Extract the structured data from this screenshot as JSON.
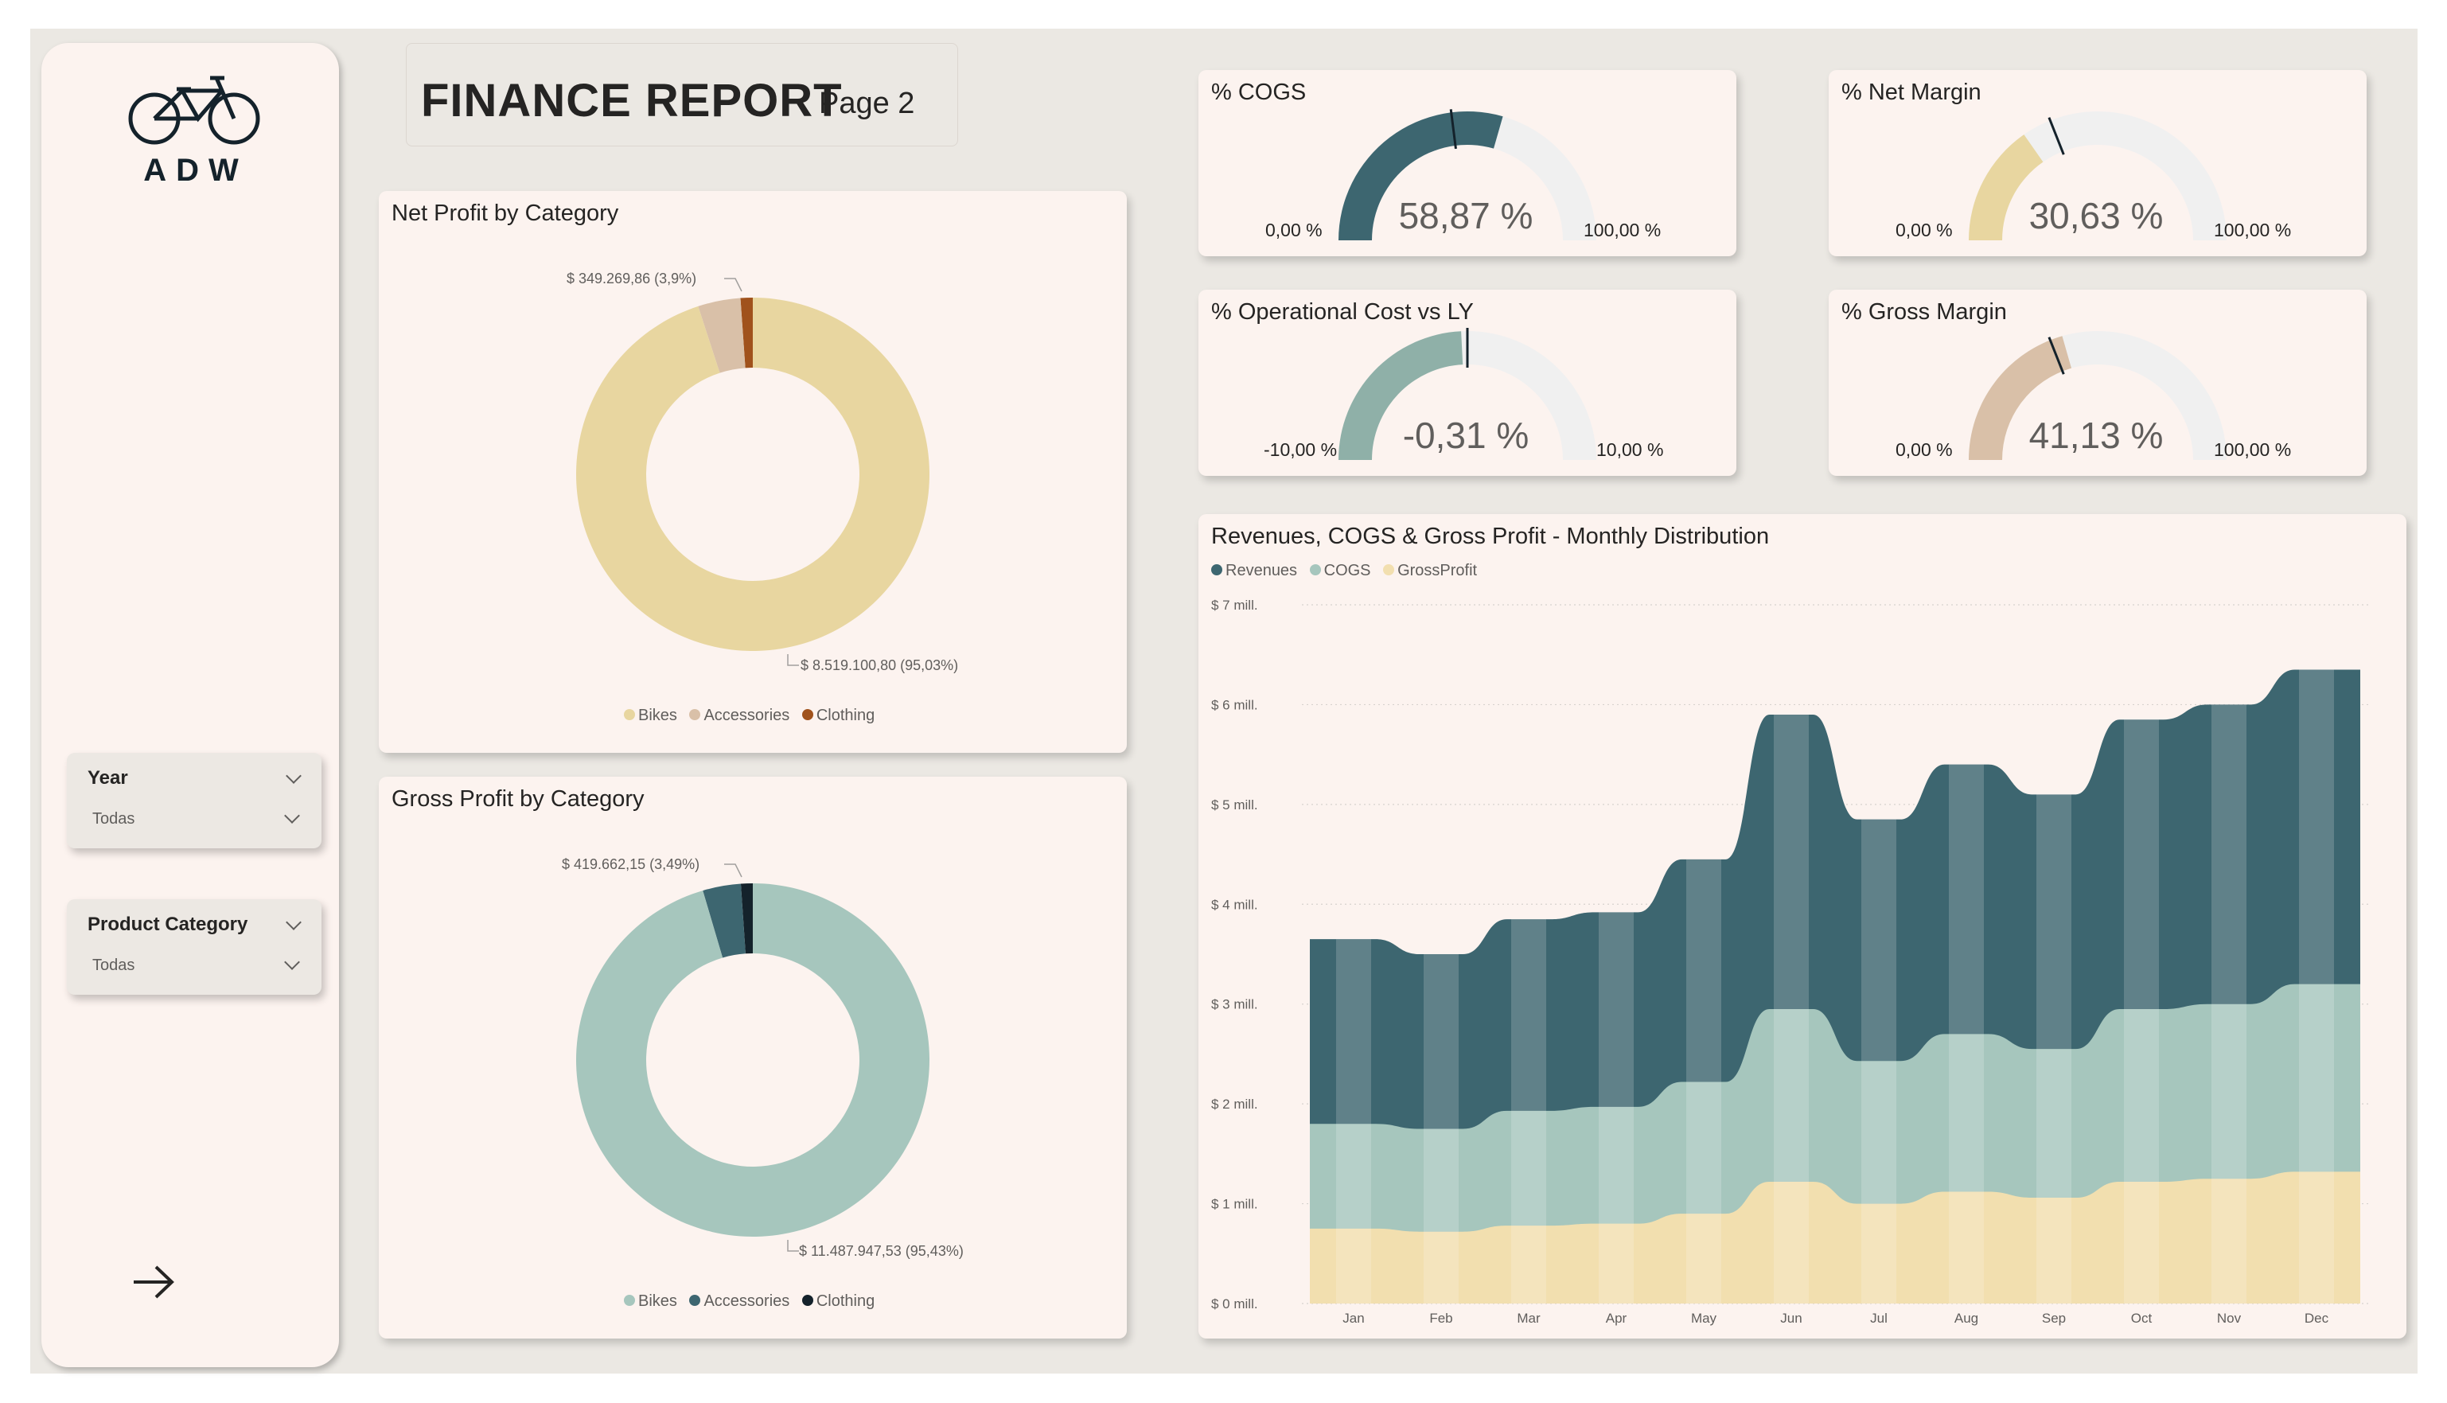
{
  "report": {
    "title": "FINANCE REPORT",
    "subtitle": "Page 2",
    "logo_text": "ADW"
  },
  "slicers": [
    {
      "label": "Year",
      "value": "Todas"
    },
    {
      "label": "Product Category",
      "value": "Todas"
    }
  ],
  "nav": {
    "icon": "arrow-right-icon"
  },
  "gauges": [
    {
      "title": "% COGS",
      "value_label": "58,87 %",
      "min_label": "0,00 %",
      "max_label": "100,00 %",
      "value": 58.87,
      "min": 0,
      "max": 100,
      "target": 46,
      "color": "#3d6670"
    },
    {
      "title": "% Net Margin",
      "value_label": "30,63 %",
      "min_label": "0,00 %",
      "max_label": "100,00 %",
      "value": 30.63,
      "min": 0,
      "max": 100,
      "target": 38,
      "color": "#e8d6a0"
    },
    {
      "title": "% Operational Cost vs LY",
      "value_label": "-0,31 %",
      "min_label": "-10,00 %",
      "max_label": "10,00 %",
      "value": -0.31,
      "min": -10,
      "max": 10,
      "target": 0,
      "color": "#8fb0a8"
    },
    {
      "title": "% Gross Margin",
      "value_label": "41,13 %",
      "min_label": "0,00 %",
      "max_label": "100,00 %",
      "value": 41.13,
      "min": 0,
      "max": 100,
      "target": 38,
      "color": "#d9c0a8"
    }
  ],
  "chart_data": [
    {
      "type": "pie",
      "title": "Net Profit by Category",
      "categories": [
        "Bikes",
        "Accessories",
        "Clothing"
      ],
      "values": [
        8519100.8,
        349269.86,
        100000
      ],
      "colors": [
        "#e8d6a0",
        "#d9c0a8",
        "#a0521c"
      ],
      "data_labels": {
        "bikes": "$ 8.519.100,80 (95,03%)",
        "accessories": "$ 349.269,86 (3,9%)"
      },
      "legend": "bottom"
    },
    {
      "type": "pie",
      "title": "Gross Profit by Category",
      "categories": [
        "Bikes",
        "Accessories",
        "Clothing"
      ],
      "values": [
        11487947.53,
        419662.15,
        130000
      ],
      "colors": [
        "#a6c6bd",
        "#3d6670",
        "#14222b"
      ],
      "data_labels": {
        "bikes": "$ 11.487.947,53 (95,43%)",
        "accessories": "$ 419.662,15 (3,49%)"
      },
      "legend": "bottom"
    },
    {
      "type": "area",
      "title": "Revenues, COGS & Gross Profit - Monthly Distribution",
      "categories": [
        "Jan",
        "Feb",
        "Mar",
        "Apr",
        "May",
        "Jun",
        "Jul",
        "Aug",
        "Sep",
        "Oct",
        "Nov",
        "Dec"
      ],
      "y_ticks": [
        "$ 0 mill.",
        "$ 1 mill.",
        "$ 2 mill.",
        "$ 3 mill.",
        "$ 4 mill.",
        "$ 5 mill.",
        "$ 6 mill.",
        "$ 7 mill."
      ],
      "ylim": [
        0,
        7
      ],
      "grid": true,
      "legend": "top-left",
      "series": [
        {
          "name": "Revenues",
          "color": "#3d6670",
          "values": [
            3.65,
            3.5,
            3.85,
            3.92,
            4.45,
            5.9,
            4.85,
            5.4,
            5.1,
            5.85,
            6.0,
            6.35
          ]
        },
        {
          "name": "COGS",
          "color": "#a6c6bd",
          "values": [
            1.8,
            1.75,
            1.93,
            1.97,
            2.22,
            2.95,
            2.43,
            2.7,
            2.55,
            2.95,
            3.0,
            3.2
          ]
        },
        {
          "name": "GrossProfit",
          "color": "#f2dfaf",
          "values": [
            0.75,
            0.72,
            0.78,
            0.8,
            0.9,
            1.22,
            1.0,
            1.12,
            1.06,
            1.22,
            1.25,
            1.32
          ]
        }
      ]
    }
  ]
}
